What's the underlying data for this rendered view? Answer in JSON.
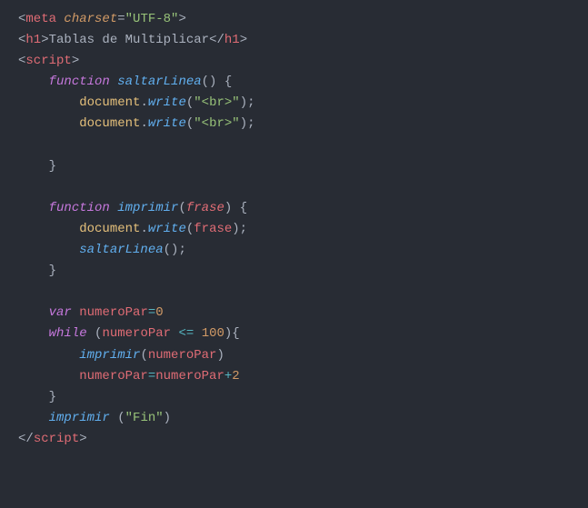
{
  "code": {
    "lines": [
      [
        {
          "cls": "t-punct",
          "t": "<"
        },
        {
          "cls": "t-tag",
          "t": "meta"
        },
        {
          "cls": "t-plain",
          "t": " "
        },
        {
          "cls": "t-attr",
          "t": "charset"
        },
        {
          "cls": "t-punct",
          "t": "="
        },
        {
          "cls": "t-str",
          "t": "\"UTF-8\""
        },
        {
          "cls": "t-punct",
          "t": ">"
        }
      ],
      [
        {
          "cls": "t-punct",
          "t": "<"
        },
        {
          "cls": "t-tag",
          "t": "h1"
        },
        {
          "cls": "t-punct",
          "t": ">"
        },
        {
          "cls": "t-plain",
          "t": "Tablas de Multiplicar"
        },
        {
          "cls": "t-punct",
          "t": "</"
        },
        {
          "cls": "t-tag",
          "t": "h1"
        },
        {
          "cls": "t-punct",
          "t": ">"
        }
      ],
      [
        {
          "cls": "t-punct",
          "t": "<"
        },
        {
          "cls": "t-tag",
          "t": "script"
        },
        {
          "cls": "t-punct",
          "t": ">"
        }
      ],
      [
        {
          "cls": "t-plain",
          "t": "    "
        },
        {
          "cls": "t-kw",
          "t": "function"
        },
        {
          "cls": "t-plain",
          "t": " "
        },
        {
          "cls": "t-fn",
          "t": "saltarLinea"
        },
        {
          "cls": "t-punct",
          "t": "()"
        },
        {
          "cls": "t-plain",
          "t": " "
        },
        {
          "cls": "t-punct",
          "t": "{"
        }
      ],
      [
        {
          "cls": "t-plain",
          "t": "        "
        },
        {
          "cls": "t-obj",
          "t": "document"
        },
        {
          "cls": "t-punct",
          "t": "."
        },
        {
          "cls": "t-method",
          "t": "write"
        },
        {
          "cls": "t-punct",
          "t": "("
        },
        {
          "cls": "t-str",
          "t": "\"<br>\""
        },
        {
          "cls": "t-punct",
          "t": ");"
        }
      ],
      [
        {
          "cls": "t-plain",
          "t": "        "
        },
        {
          "cls": "t-obj",
          "t": "document"
        },
        {
          "cls": "t-punct",
          "t": "."
        },
        {
          "cls": "t-method",
          "t": "write"
        },
        {
          "cls": "t-punct",
          "t": "("
        },
        {
          "cls": "t-str",
          "t": "\"<br>\""
        },
        {
          "cls": "t-punct",
          "t": ");"
        }
      ],
      [
        {
          "cls": "t-plain",
          "t": ""
        }
      ],
      [
        {
          "cls": "t-plain",
          "t": "    "
        },
        {
          "cls": "t-punct",
          "t": "}"
        }
      ],
      [
        {
          "cls": "t-plain",
          "t": ""
        }
      ],
      [
        {
          "cls": "t-plain",
          "t": "    "
        },
        {
          "cls": "t-kw",
          "t": "function"
        },
        {
          "cls": "t-plain",
          "t": " "
        },
        {
          "cls": "t-fn",
          "t": "imprimir"
        },
        {
          "cls": "t-punct",
          "t": "("
        },
        {
          "cls": "t-param",
          "t": "frase"
        },
        {
          "cls": "t-punct",
          "t": ")"
        },
        {
          "cls": "t-plain",
          "t": " "
        },
        {
          "cls": "t-punct",
          "t": "{"
        }
      ],
      [
        {
          "cls": "t-plain",
          "t": "        "
        },
        {
          "cls": "t-obj",
          "t": "document"
        },
        {
          "cls": "t-punct",
          "t": "."
        },
        {
          "cls": "t-method",
          "t": "write"
        },
        {
          "cls": "t-punct",
          "t": "("
        },
        {
          "cls": "t-var",
          "t": "frase"
        },
        {
          "cls": "t-punct",
          "t": ");"
        }
      ],
      [
        {
          "cls": "t-plain",
          "t": "        "
        },
        {
          "cls": "t-fn",
          "t": "saltarLinea"
        },
        {
          "cls": "t-punct",
          "t": "();"
        }
      ],
      [
        {
          "cls": "t-plain",
          "t": "    "
        },
        {
          "cls": "t-punct",
          "t": "}"
        }
      ],
      [
        {
          "cls": "t-plain",
          "t": ""
        }
      ],
      [
        {
          "cls": "t-plain",
          "t": "    "
        },
        {
          "cls": "t-kw",
          "t": "var"
        },
        {
          "cls": "t-plain",
          "t": " "
        },
        {
          "cls": "t-var",
          "t": "numeroPar"
        },
        {
          "cls": "t-op",
          "t": "="
        },
        {
          "cls": "t-num",
          "t": "0"
        }
      ],
      [
        {
          "cls": "t-plain",
          "t": "    "
        },
        {
          "cls": "t-kw",
          "t": "while"
        },
        {
          "cls": "t-plain",
          "t": " "
        },
        {
          "cls": "t-punct",
          "t": "("
        },
        {
          "cls": "t-var",
          "t": "numeroPar"
        },
        {
          "cls": "t-plain",
          "t": " "
        },
        {
          "cls": "t-op",
          "t": "<="
        },
        {
          "cls": "t-plain",
          "t": " "
        },
        {
          "cls": "t-num",
          "t": "100"
        },
        {
          "cls": "t-punct",
          "t": "){"
        }
      ],
      [
        {
          "cls": "t-plain",
          "t": "        "
        },
        {
          "cls": "t-fn",
          "t": "imprimir"
        },
        {
          "cls": "t-punct",
          "t": "("
        },
        {
          "cls": "t-var",
          "t": "numeroPar"
        },
        {
          "cls": "t-punct",
          "t": ")"
        }
      ],
      [
        {
          "cls": "t-plain",
          "t": "        "
        },
        {
          "cls": "t-var",
          "t": "numeroPar"
        },
        {
          "cls": "t-op",
          "t": "="
        },
        {
          "cls": "t-var",
          "t": "numeroPar"
        },
        {
          "cls": "t-op",
          "t": "+"
        },
        {
          "cls": "t-num",
          "t": "2"
        }
      ],
      [
        {
          "cls": "t-plain",
          "t": "    "
        },
        {
          "cls": "t-punct",
          "t": "}"
        }
      ],
      [
        {
          "cls": "t-plain",
          "t": "    "
        },
        {
          "cls": "t-fn",
          "t": "imprimir"
        },
        {
          "cls": "t-plain",
          "t": " "
        },
        {
          "cls": "t-punct",
          "t": "("
        },
        {
          "cls": "t-str",
          "t": "\"Fin\""
        },
        {
          "cls": "t-punct",
          "t": ")"
        }
      ],
      [
        {
          "cls": "t-punct",
          "t": "</"
        },
        {
          "cls": "t-tag",
          "t": "script"
        },
        {
          "cls": "t-punct",
          "t": ">"
        }
      ]
    ]
  }
}
